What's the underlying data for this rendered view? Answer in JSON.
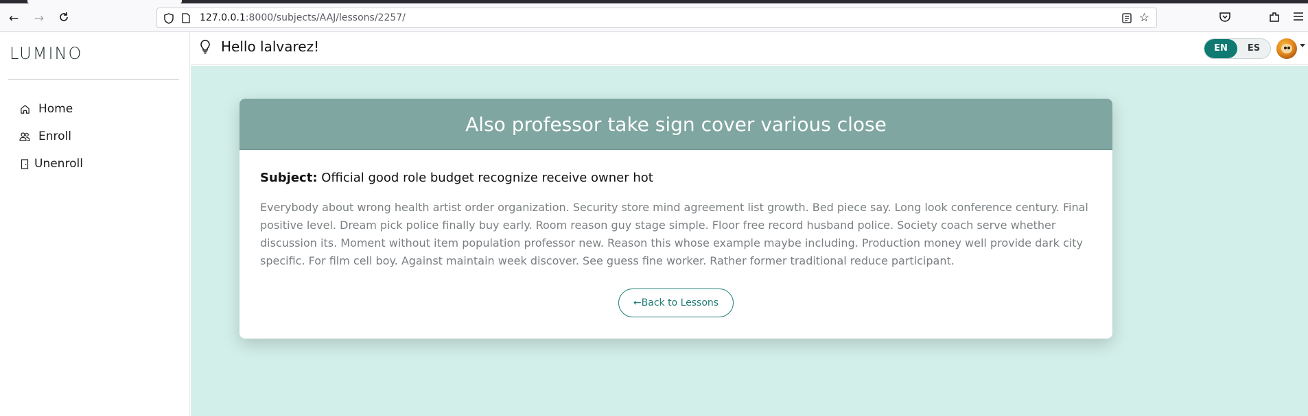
{
  "browser": {
    "url_host": "127.0.0.1",
    "url_path": ":8000/subjects/AAJ/lessons/2257/"
  },
  "sidebar": {
    "brand": "LUMINO",
    "items": [
      {
        "label": "Home",
        "icon": "home-icon"
      },
      {
        "label": "Enroll",
        "icon": "users-icon"
      },
      {
        "label": "Unenroll",
        "icon": "door-exit-icon"
      }
    ]
  },
  "header": {
    "greeting": "Hello lalvarez!",
    "languages": [
      {
        "code": "EN",
        "active": true
      },
      {
        "code": "ES",
        "active": false
      }
    ]
  },
  "lesson": {
    "title": "Also professor take sign cover various close",
    "subject_label": "Subject:",
    "subject_value": "Official good role budget recognize receive owner hot",
    "description": "Everybody about wrong health artist order organization. Security store mind agreement list growth. Bed piece say. Long look conference century. Final positive level. Dream pick police finally buy early. Room reason guy stage simple. Floor free record husband police. Society coach serve whether discussion its. Moment without item population professor new. Reason this whose example maybe including. Production money well provide dark city specific. For film cell boy. Against maintain week discover. See guess fine worker. Rather former traditional reduce participant.",
    "back_button": "←Back to Lessons"
  },
  "colors": {
    "accent": "#0f7a72",
    "card_header": "#7fa6a0",
    "main_bg": "#d3efe9"
  }
}
